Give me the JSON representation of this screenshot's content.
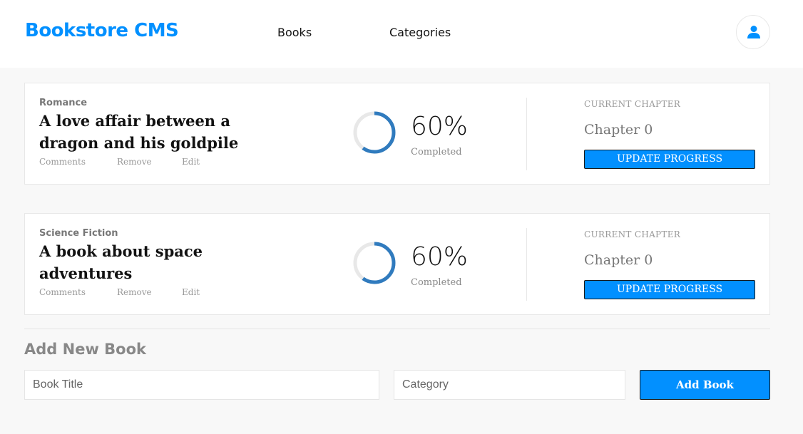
{
  "app": {
    "title": "Bookstore CMS"
  },
  "nav": {
    "books": "Books",
    "categories": "Categories"
  },
  "user": {
    "icon": "user-icon"
  },
  "books": [
    {
      "category": "Romance",
      "title": "A love affair between a dragon and his goldpile",
      "actions": {
        "comments": "Comments",
        "remove": "Remove",
        "edit": "Edit"
      },
      "progress": {
        "percent_label": "60%",
        "value": 60,
        "completed_label": "Completed"
      },
      "current_chapter_label": "CURRENT CHAPTER",
      "chapter": "Chapter 0",
      "update_label": "UPDATE PROGRESS"
    },
    {
      "category": "Science Fiction",
      "title": "A book about space adventures",
      "actions": {
        "comments": "Comments",
        "remove": "Remove",
        "edit": "Edit"
      },
      "progress": {
        "percent_label": "60%",
        "value": 60,
        "completed_label": "Completed"
      },
      "current_chapter_label": "CURRENT CHAPTER",
      "chapter": "Chapter 0",
      "update_label": "UPDATE PROGRESS"
    }
  ],
  "add_form": {
    "heading": "Add New Book",
    "title_placeholder": "Book Title",
    "category_placeholder": "Category",
    "submit_label": "Add Book"
  },
  "colors": {
    "accent": "#0290ff",
    "progress": "#307bbe",
    "track": "#e8e8e8"
  }
}
